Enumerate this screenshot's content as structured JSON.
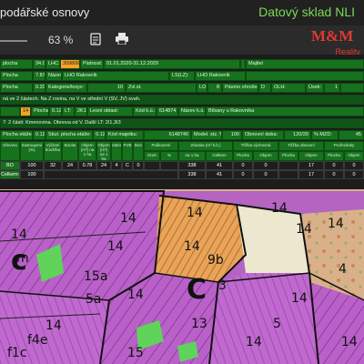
{
  "app": {
    "title": "podářské osnovy",
    "brand": "Datový sklad NLI",
    "zoom": "63 %",
    "logo_text": "M&M",
    "logo_sub": "Reality"
  },
  "row1": {
    "plocha_label": "plocha",
    "plocha_value": "34.02",
    "lhc_label": "LHC:",
    "lhc_value": "309806",
    "platnost_label": "Platnost:",
    "platnost_value": "01.01.2020-31.12.2029",
    "majitel_label": "Majitel"
  },
  "row2": {
    "plocha_label": "Plocha",
    "plocha_value": "7.87",
    "nazev_label": "Název:",
    "nazev_value": "LHO Rakovník",
    "ls_label": "LS(LZ):",
    "ls_value": "LHO Rakovník"
  },
  "row3": {
    "plocha_label": "Plocha",
    "plocha_value": "0.20",
    "kategorie_label": "Kategorie/lesyv:",
    "kategorie_value": "10",
    "zvl_label": "Zvl.st.",
    "lo_label": "LO:",
    "lo_value": "8",
    "pasmo_label": "Pásmo ohrožení:",
    "pasmo_value": "D",
    "olh_label": "OLH:",
    "usek_label": "Úsek:",
    "usek_value": "1"
  },
  "row4": {
    "text": "ná ve 2 částech. Na Z rovina, na V ve střední V (SV, JV) svah."
  },
  "row5": {
    "c1": "14",
    "plocha_label": "Plocha",
    "plocha_value": "0.12",
    "lt_label": "LT:",
    "lt_value": "2K1",
    "lesni_label": "Lesní oblast:",
    "kod_label": "Kód k.ú.:",
    "kod_value": "614874",
    "nazev_label": "Název k.ú.:",
    "nazev_value": "Bílsany u Rakovníka"
  },
  "row6": {
    "text": "7: 2 části: Kmenovina. Obnova od V. Další LT: 2I1,3I3"
  },
  "row7": {
    "plocha_label": "Plocha etáže:",
    "plocha_value": "0.12",
    "skut_label": "Skut. plocha etáže:",
    "skut_value": "0.12",
    "kod_label": "Kód majetku:",
    "kod_value": "6148740",
    "model_label": "Model. stz. %",
    "model_value": "100",
    "obnova_label": "Obnovní doba:",
    "obnova_value": "120/20",
    "mzd_label": "% MZD:",
    "mzd_value": "45"
  },
  "table": {
    "headers": [
      "Dřevina",
      "Zastoupení (%)",
      "Výčetní tloušťka",
      "Bonita",
      "Objem (m³) na 1 ha",
      "Objem (m³) na 1 ha",
      "Zakm",
      "PVB",
      "Bon",
      "Poškození",
      "Zásoba (m³ k.b.)",
      "Těžba výchovná",
      "Těžba obnovní",
      "Prořezávky"
    ],
    "subheaders": [
      "Druh",
      "%",
      "na 1 ha",
      "Celkem",
      "Plocha",
      "Objem",
      "Plocha",
      "Objem",
      "Plocha",
      "Objem"
    ],
    "row_bo": [
      "BO",
      "100",
      "32",
      "24",
      "0.78",
      "24",
      "4",
      "C",
      "0",
      "338",
      "41",
      "0",
      "0",
      "17",
      "0",
      "0"
    ],
    "row_total": [
      "Celkem:",
      "100",
      "338",
      "41",
      "0",
      "0",
      "17",
      "0",
      "0"
    ]
  },
  "map_labels": [
    "14",
    "14",
    "14",
    "14",
    "14",
    "14",
    "14",
    "14",
    "9b",
    "c",
    "C",
    "15a",
    "f1c",
    "f4e",
    "15",
    "5a",
    "3",
    "4",
    "5",
    "13",
    "14",
    "14",
    "14",
    "14",
    "14",
    "m"
  ]
}
